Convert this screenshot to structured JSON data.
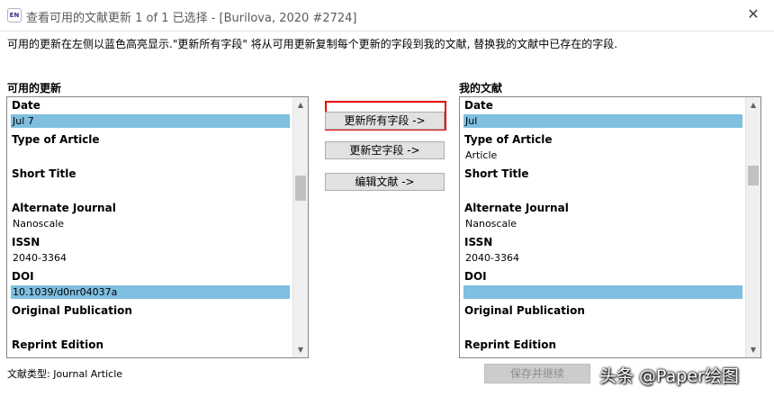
{
  "titlebar": {
    "icon_text": "EN",
    "title": "查看可用的文献更新 1 of 1 已选择 - [Burilova, 2020 #2724]",
    "close": "✕"
  },
  "instruction": "可用的更新在左侧以蓝色高亮显示.\"更新所有字段\" 将从可用更新复制每个更新的字段到我的文献, 替换我的文献中已存在的字段.",
  "left": {
    "label": "可用的更新",
    "fields": [
      {
        "name": "Date",
        "value": "Jul 7",
        "highlight": true
      },
      {
        "name": "Type of Article",
        "value": "",
        "highlight": false
      },
      {
        "name": "Short Title",
        "value": "",
        "highlight": false
      },
      {
        "name": "Alternate Journal",
        "value": "Nanoscale",
        "highlight": false
      },
      {
        "name": "ISSN",
        "value": "2040-3364",
        "highlight": false
      },
      {
        "name": "DOI",
        "value": "10.1039/d0nr04037a",
        "highlight": true
      },
      {
        "name": "Original Publication",
        "value": "",
        "highlight": false
      },
      {
        "name": "Reprint Edition",
        "value": "",
        "highlight": false
      }
    ]
  },
  "right": {
    "label": "我的文献",
    "fields": [
      {
        "name": "Date",
        "value": "Jul",
        "highlight": true
      },
      {
        "name": "Type of Article",
        "value": "Article",
        "highlight": false
      },
      {
        "name": "Short Title",
        "value": "",
        "highlight": false
      },
      {
        "name": "Alternate Journal",
        "value": "Nanoscale",
        "highlight": false
      },
      {
        "name": "ISSN",
        "value": "2040-3364",
        "highlight": false
      },
      {
        "name": "DOI",
        "value": "",
        "highlight": true
      },
      {
        "name": "Original Publication",
        "value": "",
        "highlight": false
      },
      {
        "name": "Reprint Edition",
        "value": "",
        "highlight": false
      }
    ]
  },
  "buttons": {
    "update_all": "更新所有字段 ->",
    "update_empty": "更新空字段 ->",
    "edit_reference": "编辑文献 ->"
  },
  "status": "文献类型: Journal Article",
  "save_continue": "保存并继续",
  "watermark": "头条 @Paper绘图",
  "scroll_glyphs": {
    "up": "▲",
    "down": "▼"
  },
  "colors": {
    "highlight": "#7fbfe0",
    "emphasis_border": "#e60000"
  }
}
